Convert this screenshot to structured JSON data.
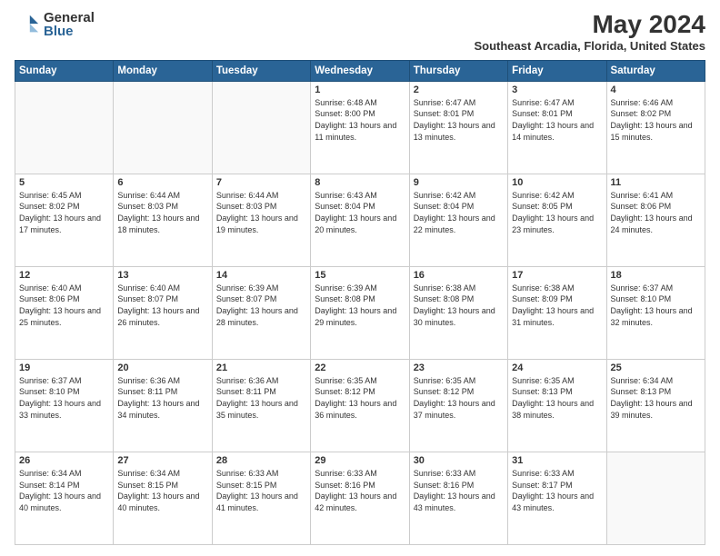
{
  "header": {
    "logo_general": "General",
    "logo_blue": "Blue",
    "month_title": "May 2024",
    "location": "Southeast Arcadia, Florida, United States"
  },
  "days_of_week": [
    "Sunday",
    "Monday",
    "Tuesday",
    "Wednesday",
    "Thursday",
    "Friday",
    "Saturday"
  ],
  "weeks": [
    [
      {
        "day": "",
        "info": ""
      },
      {
        "day": "",
        "info": ""
      },
      {
        "day": "",
        "info": ""
      },
      {
        "day": "1",
        "info": "Sunrise: 6:48 AM\nSunset: 8:00 PM\nDaylight: 13 hours and 11 minutes."
      },
      {
        "day": "2",
        "info": "Sunrise: 6:47 AM\nSunset: 8:01 PM\nDaylight: 13 hours and 13 minutes."
      },
      {
        "day": "3",
        "info": "Sunrise: 6:47 AM\nSunset: 8:01 PM\nDaylight: 13 hours and 14 minutes."
      },
      {
        "day": "4",
        "info": "Sunrise: 6:46 AM\nSunset: 8:02 PM\nDaylight: 13 hours and 15 minutes."
      }
    ],
    [
      {
        "day": "5",
        "info": "Sunrise: 6:45 AM\nSunset: 8:02 PM\nDaylight: 13 hours and 17 minutes."
      },
      {
        "day": "6",
        "info": "Sunrise: 6:44 AM\nSunset: 8:03 PM\nDaylight: 13 hours and 18 minutes."
      },
      {
        "day": "7",
        "info": "Sunrise: 6:44 AM\nSunset: 8:03 PM\nDaylight: 13 hours and 19 minutes."
      },
      {
        "day": "8",
        "info": "Sunrise: 6:43 AM\nSunset: 8:04 PM\nDaylight: 13 hours and 20 minutes."
      },
      {
        "day": "9",
        "info": "Sunrise: 6:42 AM\nSunset: 8:04 PM\nDaylight: 13 hours and 22 minutes."
      },
      {
        "day": "10",
        "info": "Sunrise: 6:42 AM\nSunset: 8:05 PM\nDaylight: 13 hours and 23 minutes."
      },
      {
        "day": "11",
        "info": "Sunrise: 6:41 AM\nSunset: 8:06 PM\nDaylight: 13 hours and 24 minutes."
      }
    ],
    [
      {
        "day": "12",
        "info": "Sunrise: 6:40 AM\nSunset: 8:06 PM\nDaylight: 13 hours and 25 minutes."
      },
      {
        "day": "13",
        "info": "Sunrise: 6:40 AM\nSunset: 8:07 PM\nDaylight: 13 hours and 26 minutes."
      },
      {
        "day": "14",
        "info": "Sunrise: 6:39 AM\nSunset: 8:07 PM\nDaylight: 13 hours and 28 minutes."
      },
      {
        "day": "15",
        "info": "Sunrise: 6:39 AM\nSunset: 8:08 PM\nDaylight: 13 hours and 29 minutes."
      },
      {
        "day": "16",
        "info": "Sunrise: 6:38 AM\nSunset: 8:08 PM\nDaylight: 13 hours and 30 minutes."
      },
      {
        "day": "17",
        "info": "Sunrise: 6:38 AM\nSunset: 8:09 PM\nDaylight: 13 hours and 31 minutes."
      },
      {
        "day": "18",
        "info": "Sunrise: 6:37 AM\nSunset: 8:10 PM\nDaylight: 13 hours and 32 minutes."
      }
    ],
    [
      {
        "day": "19",
        "info": "Sunrise: 6:37 AM\nSunset: 8:10 PM\nDaylight: 13 hours and 33 minutes."
      },
      {
        "day": "20",
        "info": "Sunrise: 6:36 AM\nSunset: 8:11 PM\nDaylight: 13 hours and 34 minutes."
      },
      {
        "day": "21",
        "info": "Sunrise: 6:36 AM\nSunset: 8:11 PM\nDaylight: 13 hours and 35 minutes."
      },
      {
        "day": "22",
        "info": "Sunrise: 6:35 AM\nSunset: 8:12 PM\nDaylight: 13 hours and 36 minutes."
      },
      {
        "day": "23",
        "info": "Sunrise: 6:35 AM\nSunset: 8:12 PM\nDaylight: 13 hours and 37 minutes."
      },
      {
        "day": "24",
        "info": "Sunrise: 6:35 AM\nSunset: 8:13 PM\nDaylight: 13 hours and 38 minutes."
      },
      {
        "day": "25",
        "info": "Sunrise: 6:34 AM\nSunset: 8:13 PM\nDaylight: 13 hours and 39 minutes."
      }
    ],
    [
      {
        "day": "26",
        "info": "Sunrise: 6:34 AM\nSunset: 8:14 PM\nDaylight: 13 hours and 40 minutes."
      },
      {
        "day": "27",
        "info": "Sunrise: 6:34 AM\nSunset: 8:15 PM\nDaylight: 13 hours and 40 minutes."
      },
      {
        "day": "28",
        "info": "Sunrise: 6:33 AM\nSunset: 8:15 PM\nDaylight: 13 hours and 41 minutes."
      },
      {
        "day": "29",
        "info": "Sunrise: 6:33 AM\nSunset: 8:16 PM\nDaylight: 13 hours and 42 minutes."
      },
      {
        "day": "30",
        "info": "Sunrise: 6:33 AM\nSunset: 8:16 PM\nDaylight: 13 hours and 43 minutes."
      },
      {
        "day": "31",
        "info": "Sunrise: 6:33 AM\nSunset: 8:17 PM\nDaylight: 13 hours and 43 minutes."
      },
      {
        "day": "",
        "info": ""
      }
    ]
  ]
}
